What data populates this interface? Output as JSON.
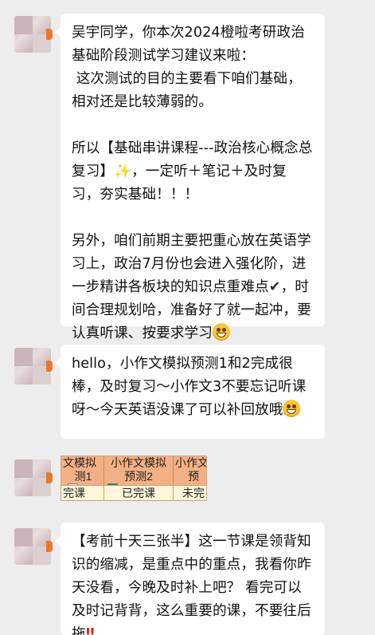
{
  "messages": [
    {
      "paragraphs": [
        "吴宇同学，你本次2024橙啦考研政治基础阶段测试学习建议来啦：\n 这次测试的目的主要看下咱们基础，相对还是比较薄弱的。",
        "所以【基础串讲课程---政治核心概念总复习】",
        "另外，咱们前期主要把重心放在英语学习上，政治7月份也会进入强化阶，进一步精讲各板块的知识点重难点"
      ],
      "p2_tail": "，一定听＋笔记＋及时复习，夯实基础！！！",
      "p3_mid": "，时间合理规划哈，准备好了就一起冲，要认真听课、按要求学习",
      "emoji": {
        "sparkles": "✨",
        "check": "✔"
      }
    },
    {
      "text": "hello，小作文模拟预测1和2完成很棒，及时复习～小作文3不要忘记听课呀～今天英语没课了可以补回放哦"
    },
    {
      "sheet": {
        "columns": [
          {
            "h1": "文模拟",
            "h2": "测1",
            "value": "完课"
          },
          {
            "h1": "小作文模拟",
            "h2": "预测2",
            "value": "已完课"
          },
          {
            "h1": "小作文",
            "h2": "预",
            "value": "未完"
          }
        ]
      }
    },
    {
      "text": "【考前十天三张半】这一节课是领背知识的缩减，是重点中的重点，我看你昨天没看，今晚及时补上吧？ 看完可以及时记背背，这么重要的课，不要往后拖",
      "emoji": {
        "double_exclaim": "‼"
      }
    }
  ],
  "colors": {
    "background": "#ededed",
    "bubble": "#ffffff",
    "avatar_accent": "#e8792b",
    "sheet_header": "#f3b085",
    "sheet_body": "#fff5d9"
  },
  "icons": [
    "avatar-image",
    "grinning-face-emoji",
    "sparkles-emoji",
    "check-mark-emoji",
    "double-exclamation-emoji",
    "filter-dropdown-icon"
  ]
}
